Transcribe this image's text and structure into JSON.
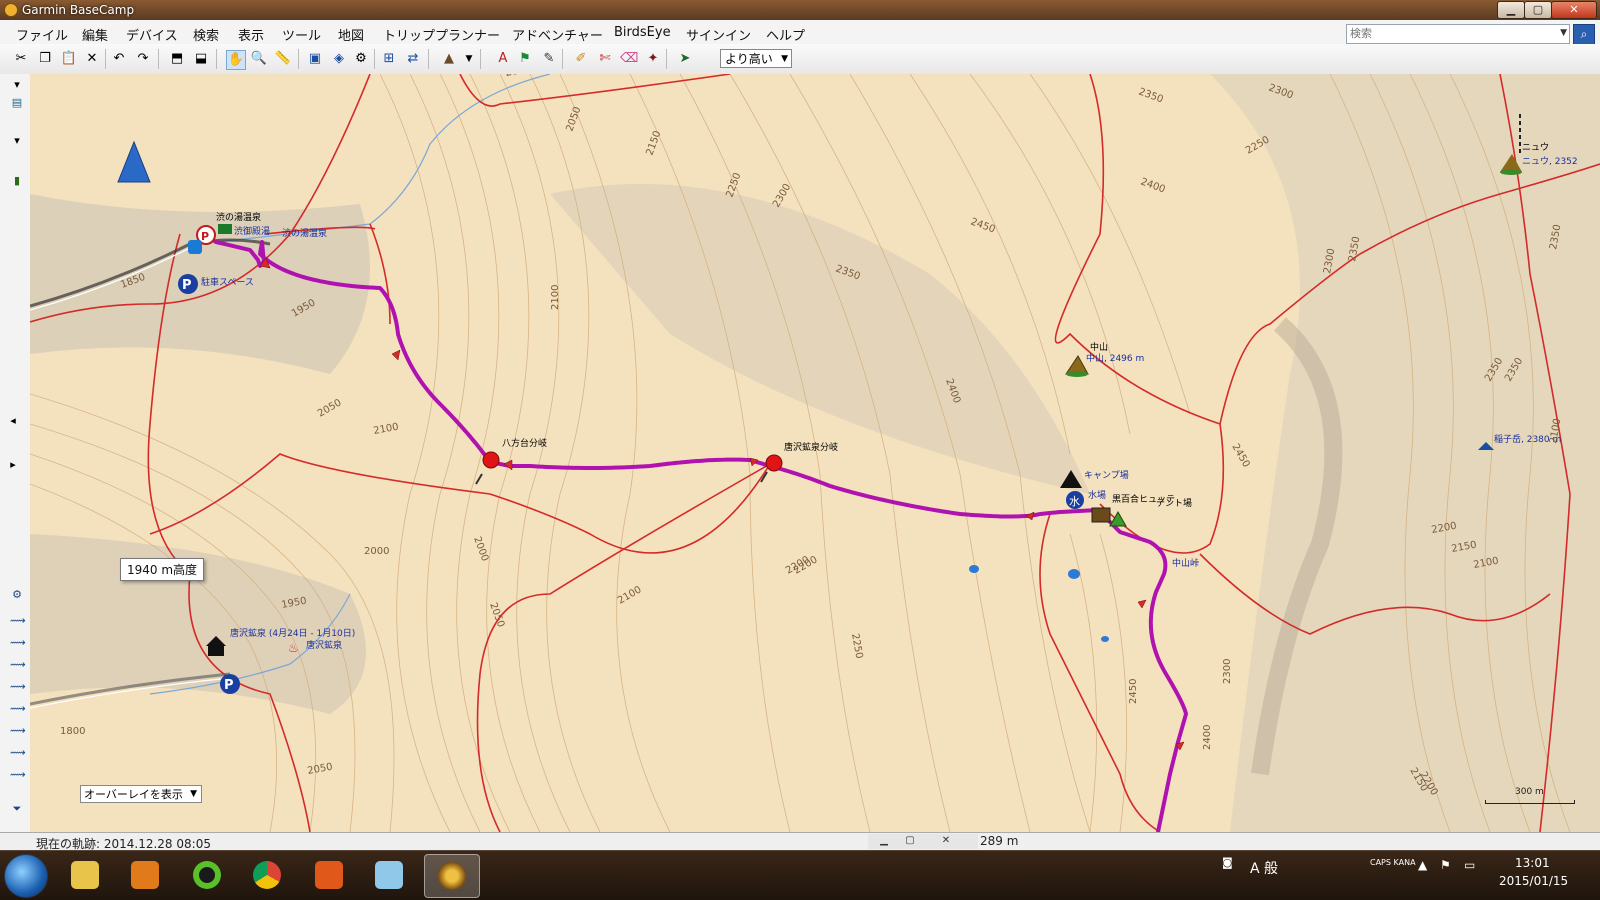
{
  "window": {
    "title": "Garmin BaseCamp",
    "min_glyph": "▁",
    "max_glyph": "▢",
    "close_glyph": "✕"
  },
  "menu": [
    "ファイル",
    "編集",
    "デバイス",
    "検索",
    "表示",
    "ツール",
    "地図",
    "トリッププランナー",
    "アドベンチャー",
    "BirdsEye",
    "サインイン",
    "ヘルプ"
  ],
  "search": {
    "placeholder": "検索",
    "value": "",
    "button_icon": "search-icon"
  },
  "toolbar": {
    "zoom_value": "より高い",
    "icons": [
      "cut-icon",
      "copy-icon",
      "paste-icon",
      "delete-icon",
      "undo-icon",
      "redo-icon",
      "receive-from-device-icon",
      "send-to-device-icon",
      "hand-tool-icon",
      "zoom-tool-icon",
      "measure-tool-icon",
      "map-2d-icon",
      "map-3d-icon",
      "filter-icon",
      "fit-map-icon",
      "sync-icon",
      "terrain-icon",
      "new-waypoint-icon",
      "new-route-icon",
      "new-track-icon",
      "edit-track-icon",
      "divide-track-icon",
      "erase-icon",
      "select-icon",
      "direction-icon"
    ]
  },
  "map": {
    "track_color": "#b012b0",
    "road_color": "#d42a2a",
    "contour_labels": [
      "2000",
      "2050",
      "2150",
      "2250",
      "2300",
      "2350",
      "2350",
      "2300",
      "2250",
      "2400",
      "2450",
      "2350",
      "2100",
      "2050",
      "1950",
      "1850",
      "2100",
      "2000",
      "1950",
      "2050",
      "2100",
      "2200",
      "2250",
      "2450",
      "2400",
      "2450",
      "2350",
      "2300",
      "2200",
      "2150",
      "2100",
      "2100",
      "2300",
      "2350",
      "2350",
      "2400",
      "2200",
      "2150",
      "1800",
      "2050",
      "2000",
      "2200"
    ],
    "waypoints": [
      {
        "name": "八方台分岐"
      },
      {
        "name": "唐沢鉱泉分岐"
      }
    ],
    "pois": [
      {
        "label": "渋の湯温泉",
        "icon": "hot-spring-icon"
      },
      {
        "label": "渋御殿湯",
        "icon": "lodge-icon"
      },
      {
        "label": "渋の湯温泉",
        "icon": "hot-spring-icon"
      },
      {
        "label": "駐車スペース",
        "icon": "parking-icon"
      },
      {
        "label": "中山",
        "icon": "peak-icon"
      },
      {
        "label": "中山, 2496 m",
        "icon": "peak-icon"
      },
      {
        "label": "ニュウ",
        "icon": "peak-icon"
      },
      {
        "label": "ニュウ, 2352",
        "icon": "peak-icon"
      },
      {
        "label": "稲子岳, 2380 m",
        "icon": "summit-icon"
      },
      {
        "label": "キャンプ場",
        "icon": "campground-icon"
      },
      {
        "label": "水場",
        "icon": "water-icon"
      },
      {
        "label": "黒百合ヒュッテ",
        "icon": "hut-icon"
      },
      {
        "label": "テント場",
        "icon": "tent-icon"
      },
      {
        "label": "中山峠",
        "icon": "pass-icon"
      },
      {
        "label": "唐沢鉱泉 (4月24日 - 1月10日)",
        "icon": "lodge-icon"
      },
      {
        "label": "唐沢鉱泉",
        "icon": "hot-spring-icon"
      }
    ],
    "elevation_tooltip": "1940 m高度",
    "overlay_select": "オーバーレイを表示",
    "scale_label": "300 m"
  },
  "status": {
    "current_track": "現在の軌跡: 2014.12.28 08:05",
    "distance": "289 m"
  },
  "taskbar": {
    "apps": [
      "explorer",
      "media-player",
      "garmin-express",
      "chrome",
      "office",
      "windows-journal",
      "basecamp"
    ],
    "ime": "A 般",
    "tray_caps": "CAPS KANA",
    "time": "13:01",
    "date": "2015/01/15"
  }
}
